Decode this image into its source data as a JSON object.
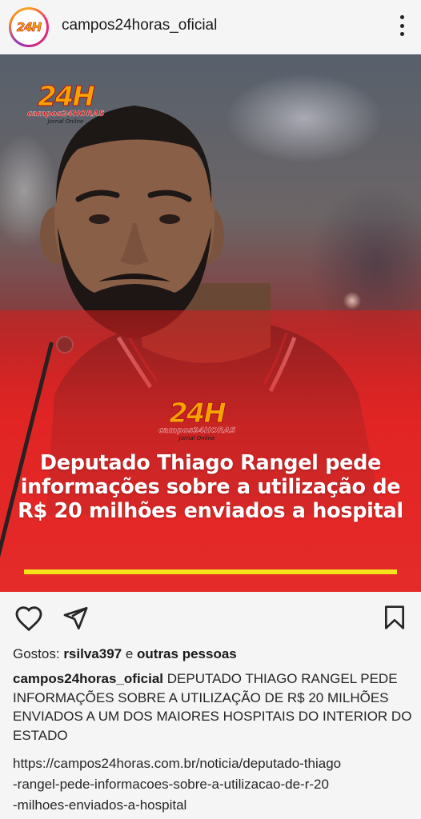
{
  "header": {
    "avatar_logo": "24H",
    "username": "campos24horas_oficial",
    "more_icon": "more-vertical-icon"
  },
  "post": {
    "logo_top": {
      "mark": "24H",
      "name": "campos24HORAS",
      "tagline": "Jornal Online"
    },
    "logo_mid": {
      "mark": "24H",
      "name": "campos24HORAS",
      "tagline": "Jornal Online"
    },
    "headline": "Deputado Thiago Rangel pede informações sobre a utilização de R$ 20 milhões enviados a hospital",
    "colors": {
      "accent_red": "#e52a2a",
      "accent_yellow": "#f5e21c",
      "logo_orange": "#f5a300"
    }
  },
  "actions": {
    "like_icon": "heart-icon",
    "share_icon": "send-icon",
    "save_icon": "bookmark-icon"
  },
  "likes": {
    "prefix": "Gostos: ",
    "user": "rsilva397",
    "middle": " e ",
    "others": "outras pessoas"
  },
  "caption": {
    "user": "campos24horas_oficial",
    "text": " DEPUTADO THIAGO RANGEL PEDE INFORMAÇÕES SOBRE A UTILIZAÇÃO DE R$ 20 MILHÕES ENVIADOS A UM DOS MAIORES HOSPITAIS DO INTERIOR DO ESTADO",
    "url_lines": [
      "https://campos24horas.com.br/noticia/deputado-thiago",
      "-rangel-pede-informacoes-sobre-a-utilizacao-de-r-20",
      "-milhoes-enviados-a-hospital"
    ]
  }
}
